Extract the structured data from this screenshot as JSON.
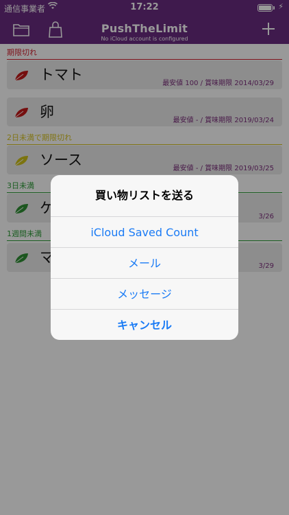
{
  "status_bar": {
    "carrier": "通信事業者",
    "time": "17:22",
    "wifi_icon": "wifi-icon",
    "battery_level": 1.0,
    "charge_icon": "charging-bolt-icon"
  },
  "nav": {
    "title": "PushTheLimit",
    "subtitle": "No iCloud account is configured",
    "left_icons": [
      "folder-icon",
      "bag-icon"
    ],
    "right_icon": "plus-icon"
  },
  "sections": [
    {
      "header": "期限切れ",
      "color": "#d21e2d",
      "items": [
        {
          "name": "トマト",
          "meta": "最安値 100 / 賞味期限 2014/03/29",
          "leaf_color": "#c41a1a"
        },
        {
          "name": "卵",
          "meta": "最安値 - / 賞味期限 2019/03/24",
          "leaf_color": "#c41a1a"
        }
      ]
    },
    {
      "header": "2日未満で期限切れ",
      "color": "#d8c324",
      "items": [
        {
          "name": "ソース",
          "meta": "最安値 - / 賞味期限 2019/03/25",
          "leaf_color": "#cfc11a"
        }
      ]
    },
    {
      "header": "3日未満",
      "color": "#2d9b38",
      "items": [
        {
          "name": "ケ",
          "meta": "3/26",
          "leaf_color": "#2f8f35"
        }
      ]
    },
    {
      "header": "1週間未満",
      "color": "#2d9b38",
      "items": [
        {
          "name": "マ",
          "meta": "3/29",
          "leaf_color": "#2f8f35"
        }
      ]
    }
  ],
  "alert": {
    "title": "買い物リストを送る",
    "buttons": [
      "iCloud Saved Count",
      "メール",
      "メッセージ"
    ],
    "cancel": "キャンセル"
  }
}
